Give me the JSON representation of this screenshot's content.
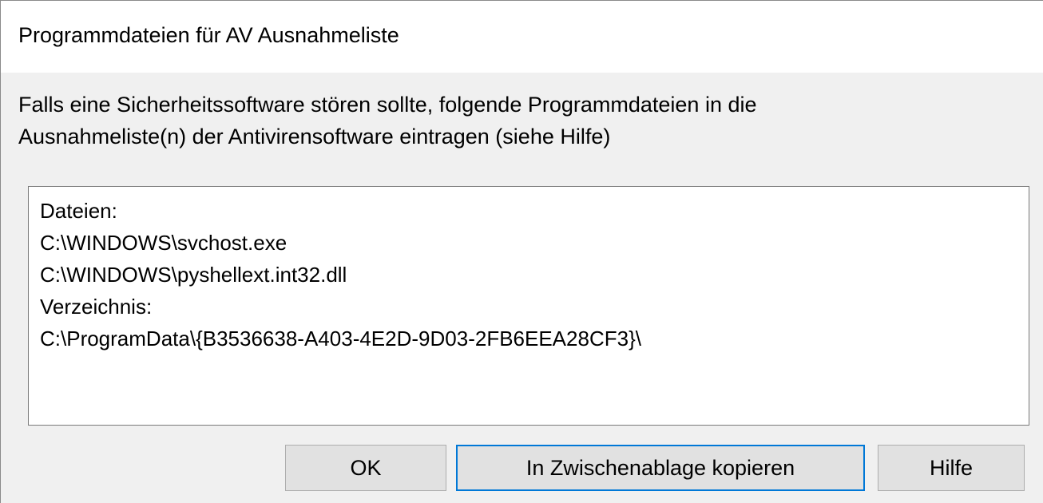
{
  "window": {
    "title": "Programmdateien für AV Ausnahmeliste"
  },
  "message": {
    "lines": [
      "Falls eine Sicherheitssoftware stören sollte, folgende Programmdateien in die",
      "Ausnahmeliste(n) der Antivirensoftware eintragen (siehe Hilfe)"
    ]
  },
  "textbox": {
    "lines": [
      "Dateien:",
      "C:\\WINDOWS\\svchost.exe",
      "C:\\WINDOWS\\pyshellext.int32.dll",
      "Verzeichnis:",
      "C:\\ProgramData\\{B3536638-A403-4E2D-9D03-2FB6EEA28CF3}\\"
    ]
  },
  "buttons": {
    "ok_label": "OK",
    "copy_label": "In Zwischenablage kopieren",
    "help_label": "Hilfe"
  },
  "colors": {
    "focus_border": "#0078d7",
    "button_face": "#e1e1e1",
    "dialog_background": "#f0f0f0"
  }
}
